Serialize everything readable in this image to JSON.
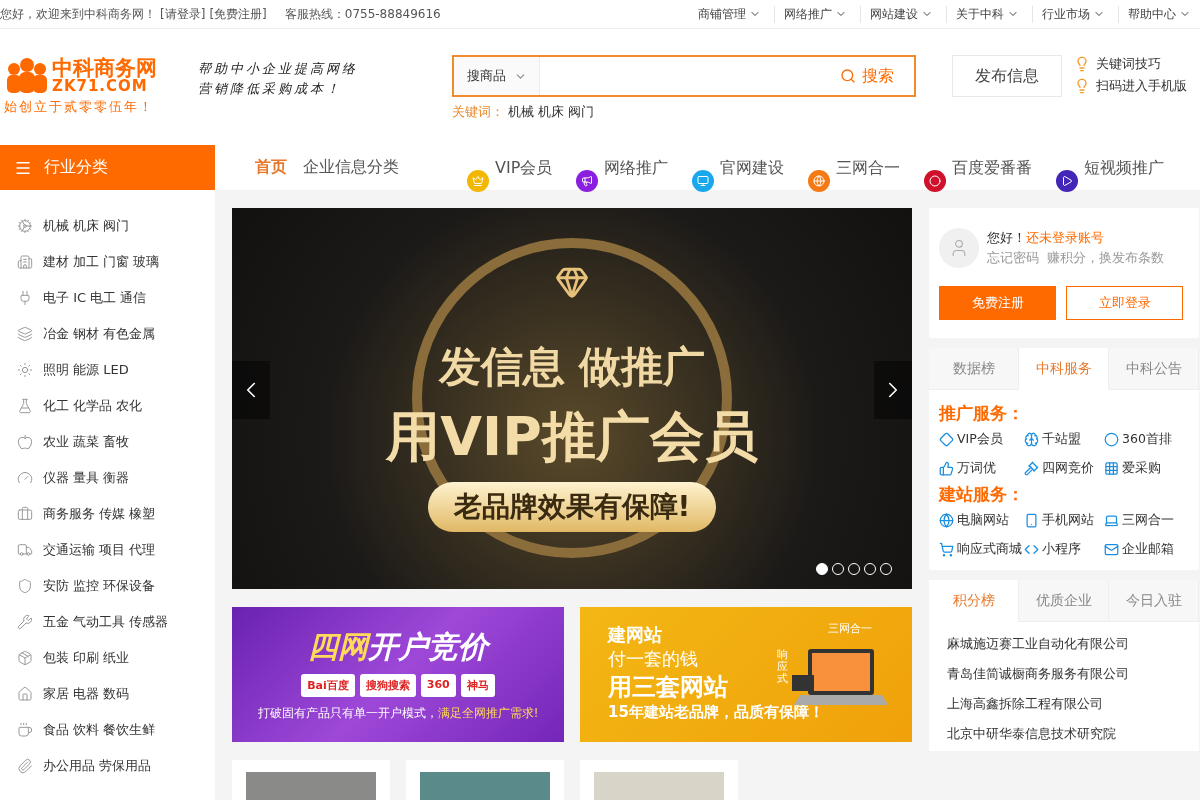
{
  "top_bar": {
    "greeting": "您好，欢迎来到中科商务网！",
    "login_link": "[请登录]",
    "register_link": "[免费注册]",
    "hotline": "客服热线：0755-88849616",
    "menus": [
      "商铺管理",
      "网络推广",
      "网站建设",
      "关于中科",
      "行业市场",
      "帮助中心"
    ]
  },
  "header": {
    "logo": {
      "name": "中科商务网",
      "domain": "ZK71.COM",
      "slogan": "始创立于贰零零伍年！"
    },
    "tagline": [
      "帮助中小企业提高网络",
      "营销降低采购成本！"
    ],
    "search": {
      "scope": "搜商品",
      "button": "搜索"
    },
    "keywords": {
      "label": "关键词：",
      "items": [
        "机械",
        "机床",
        "阀门"
      ]
    },
    "publish_button": "发布信息",
    "tips": [
      "关键词技巧",
      "扫码进入手机版"
    ]
  },
  "nav": {
    "category_button": "行业分类",
    "links": [
      {
        "label": "首页",
        "selected": true
      },
      {
        "label": "企业信息分类",
        "selected": false
      }
    ],
    "services": [
      {
        "label": "VIP会员",
        "color": "#f2b705"
      },
      {
        "label": "网络推广",
        "color": "#8a1fe0"
      },
      {
        "label": "官网建设",
        "color": "#1aa8ec"
      },
      {
        "label": "三网合一",
        "color": "#f57914"
      },
      {
        "label": "百度爱番番",
        "color": "#d0112b"
      },
      {
        "label": "短视频推广",
        "color": "#4326b8"
      }
    ]
  },
  "sidebar": {
    "items": [
      {
        "label": "机械 机床 阀门"
      },
      {
        "label": "建材 加工 门窗 玻璃"
      },
      {
        "label": "电子 IC 电工 通信"
      },
      {
        "label": "冶金 钢材 有色金属"
      },
      {
        "label": "照明 能源 LED"
      },
      {
        "label": "化工 化学品 农化"
      },
      {
        "label": "农业 蔬菜 畜牧"
      },
      {
        "label": "仪器 量具 衡器"
      },
      {
        "label": "商务服务 传媒 橡塑"
      },
      {
        "label": "交通运输 项目 代理"
      },
      {
        "label": "安防 监控 环保设备"
      },
      {
        "label": "五金 气动工具 传感器"
      },
      {
        "label": "包装 印刷 纸业"
      },
      {
        "label": "家居 电器 数码"
      },
      {
        "label": "食品 饮料 餐饮生鲜"
      },
      {
        "label": "办公用品 劳保用品"
      }
    ]
  },
  "carousel": {
    "headline": "发信息 做推广",
    "title": "用VIP推广会员",
    "ribbon": "老品牌效果有保障!",
    "dots": [
      {
        "selected": true
      },
      {
        "selected": false
      },
      {
        "selected": false
      },
      {
        "selected": false
      },
      {
        "selected": false
      }
    ]
  },
  "ads": [
    {
      "kind": "bidding",
      "title_highlight": "四网",
      "title": "开户竞价",
      "logos": [
        "Bai百度",
        "搜狗搜索",
        "360",
        "神马"
      ],
      "caption": "打破固有产品只有单一开户模式，",
      "caption_highlight": "满足全网推广需求!"
    },
    {
      "kind": "website",
      "heading": "建网站",
      "line1": "付一套的钱",
      "line2": "用三套网站",
      "footer": "15年建站老品牌，品质有保障！",
      "device_label": "三网合一",
      "side_label": "响应式"
    }
  ],
  "user_panel": {
    "greeting": "您好！",
    "status_link": "还未登录账号",
    "forgot_link": "忘记密码",
    "points_text": "赚积分，换发布条数",
    "register_button": "免费注册",
    "login_button": "立即登录"
  },
  "service_panel": {
    "tabs": [
      {
        "label": "数据榜",
        "selected": false
      },
      {
        "label": "中科服务",
        "selected": true
      },
      {
        "label": "中科公告",
        "selected": false
      }
    ],
    "sections": [
      {
        "title": "推广服务：",
        "items": [
          "VIP会员",
          "千站盟",
          "360首排",
          "万词优",
          "四网竞价",
          "爱采购"
        ]
      },
      {
        "title": "建站服务：",
        "items": [
          "电脑网站",
          "手机网站",
          "三网合一",
          "响应式商城",
          "小程序",
          "企业邮箱"
        ]
      }
    ]
  },
  "ranking_panel": {
    "tabs": [
      {
        "label": "积分榜",
        "selected": true
      },
      {
        "label": "优质企业",
        "selected": false
      },
      {
        "label": "今日入驻",
        "selected": false
      }
    ],
    "companies": [
      "麻城施迈赛工业自动化有限公司",
      "青岛佳简诚橱商务服务有限公司",
      "上海高鑫拆除工程有限公司",
      "北京中研华泰信息技术研究院"
    ]
  }
}
